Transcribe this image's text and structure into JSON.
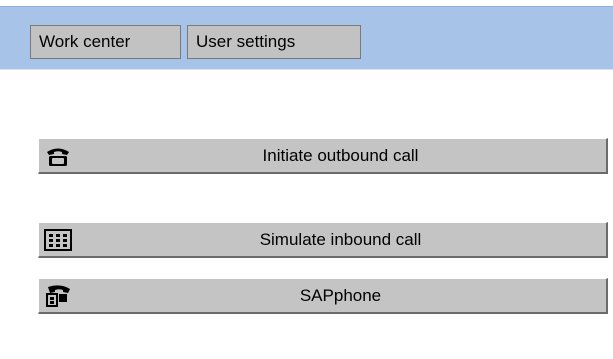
{
  "header": {
    "tabs": [
      {
        "label": "Work center"
      },
      {
        "label": "User settings"
      }
    ]
  },
  "actions": [
    {
      "label": "Initiate outbound call",
      "icon": "telephone-icon"
    },
    {
      "label": "Simulate inbound call",
      "icon": "keypad-icon"
    },
    {
      "label": "SAPphone",
      "icon": "sapphone-handset-icon"
    }
  ],
  "colors": {
    "header_bg": "#a7c3e8",
    "button_bg": "#c4c4c4",
    "tab_bg": "#c2c2c2"
  }
}
